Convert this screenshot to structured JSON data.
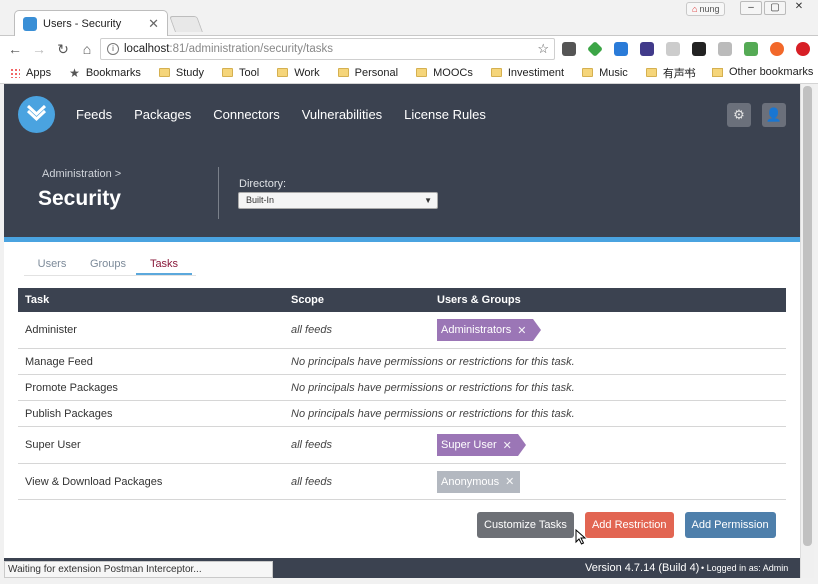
{
  "browser": {
    "tab_title": "Users - Security",
    "profile_name": "nung",
    "url_host": "localhost",
    "url_rest": ":81/administration/security/tasks",
    "status_text": "Waiting for extension Postman Interceptor..."
  },
  "bookmarks": {
    "items": [
      "Apps",
      "Bookmarks",
      "Study",
      "Tool",
      "Work",
      "Personal",
      "MOOCs",
      "Investiment",
      "Music",
      "有声书"
    ],
    "more": "»",
    "other": "Other bookmarks"
  },
  "nav": {
    "links": [
      "Feeds",
      "Packages",
      "Connectors",
      "Vulnerabilities",
      "License Rules"
    ]
  },
  "header": {
    "breadcrumb": "Administration >",
    "title": "Security",
    "directory_label": "Directory:",
    "directory_value": "Built-In"
  },
  "tabs": [
    "Users",
    "Groups",
    "Tasks"
  ],
  "table": {
    "headers": [
      "Task",
      "Scope",
      "Users & Groups"
    ],
    "rows": [
      {
        "task": "Administer",
        "scope": "all feeds",
        "principal": "Administrators"
      },
      {
        "task": "Manage Feed",
        "note": "No principals have permissions or restrictions for this task."
      },
      {
        "task": "Promote Packages",
        "note": "No principals have permissions or restrictions for this task."
      },
      {
        "task": "Publish Packages",
        "note": "No principals have permissions or restrictions for this task."
      },
      {
        "task": "Super User",
        "scope": "all feeds",
        "principal": "Super User"
      },
      {
        "task": "View & Download Packages",
        "scope": "all feeds",
        "principal": "Anonymous"
      }
    ]
  },
  "actions": {
    "customize": "Customize Tasks",
    "add_restriction": "Add Restriction",
    "add_permission": "Add Permission"
  },
  "footer": {
    "version": "Version 4.7.14 (Build 4)",
    "logged_in": "• Logged in as: Admin"
  },
  "colors": {
    "nav_bg": "#3b4250",
    "accent": "#4aa3e0",
    "pill_purple": "#9b76b6",
    "pill_gray": "#b3b8c0",
    "btn_red": "#e26552",
    "btn_blue": "#4e7fab"
  }
}
